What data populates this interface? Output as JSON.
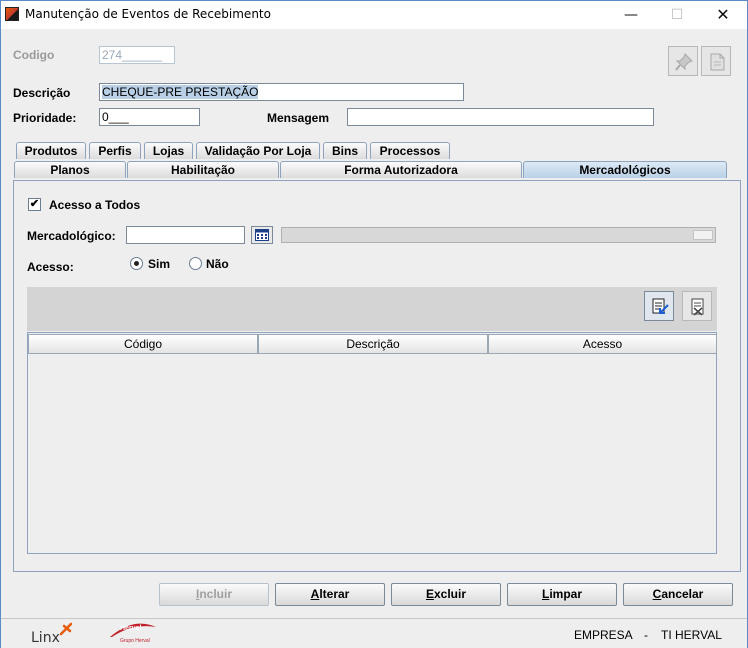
{
  "window": {
    "title": "Manutenção de Eventos de Recebimento"
  },
  "form": {
    "codigo_label": "Codigo",
    "codigo_value": "274",
    "descricao_label": "Descrição",
    "descricao_value": "CHEQUE-PRE PRESTAÇÃO",
    "prioridade_label": "Prioridade:",
    "prioridade_value": "0",
    "mensagem_label": "Mensagem",
    "mensagem_value": ""
  },
  "tabs_row1": [
    "Produtos",
    "Perfis",
    "Lojas",
    "Validação Por Loja",
    "Bins",
    "Processos"
  ],
  "tabs_row2": [
    "Planos",
    "Habilitação",
    "Forma Autorizadora",
    "Mercadológicos"
  ],
  "active_tab": "Mercadológicos",
  "panel": {
    "acesso_todos_label": "Acesso a Todos",
    "acesso_todos_checked": true,
    "mercadologico_label": "Mercadológico:",
    "mercadologico_value": "",
    "acesso_label": "Acesso:",
    "radio_sim": "Sim",
    "radio_nao": "Não",
    "selected_radio": "Sim"
  },
  "grid": {
    "columns": [
      "Código",
      "Descrição",
      "Acesso"
    ],
    "rows": []
  },
  "buttons": {
    "incluir": {
      "first": "I",
      "rest": "ncluir"
    },
    "alterar": {
      "first": "A",
      "rest": "lterar"
    },
    "excluir": {
      "first": "E",
      "rest": "xcluir"
    },
    "limpar": {
      "first": "L",
      "rest": "impar"
    },
    "cancelar": {
      "first": "C",
      "rest": "ancelar"
    }
  },
  "status": {
    "empresa_label": "EMPRESA",
    "separator": "-",
    "empresa_value": "TI HERVAL",
    "logo_linx": "Linx",
    "logo_herval": "Herval",
    "logo_herval_sub": "Grupo Herval"
  },
  "colors": {
    "accent": "#b9d1e8",
    "herval_red": "#c0202a",
    "linx_orange": "#e85a0c"
  }
}
